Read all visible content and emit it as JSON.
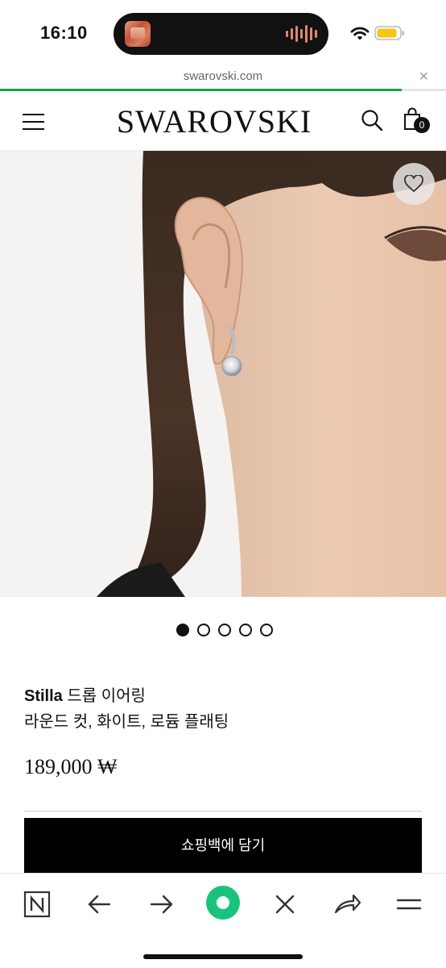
{
  "status_bar": {
    "time": "16:10"
  },
  "browser": {
    "url": "swarovski.com",
    "close_glyph": "×",
    "load_progress": 0.9
  },
  "header": {
    "brand": "SWAROVSKI",
    "bag_count": "0",
    "icons": [
      "menu-icon",
      "search-icon",
      "shopping-bag-icon"
    ]
  },
  "gallery": {
    "slide_count": 5,
    "active_slide": 1,
    "wishlist_icon": "heart-icon"
  },
  "product": {
    "name_bold": "Stilla",
    "name_rest": " 드롭 이어링",
    "variant": "라운드 컷, 화이트, 로듐 플래팅",
    "price": "189,000 ₩",
    "add_to_bag_label": "쇼핑백에 담기"
  },
  "toolbar": {
    "icons": [
      "naver-n-icon",
      "back-arrow-icon",
      "forward-arrow-icon",
      "green-home-icon",
      "close-icon",
      "share-icon",
      "more-menu-icon"
    ]
  },
  "colors": {
    "progress": "#16a34a",
    "accent_green": "#19c37d",
    "button": "#000000"
  }
}
